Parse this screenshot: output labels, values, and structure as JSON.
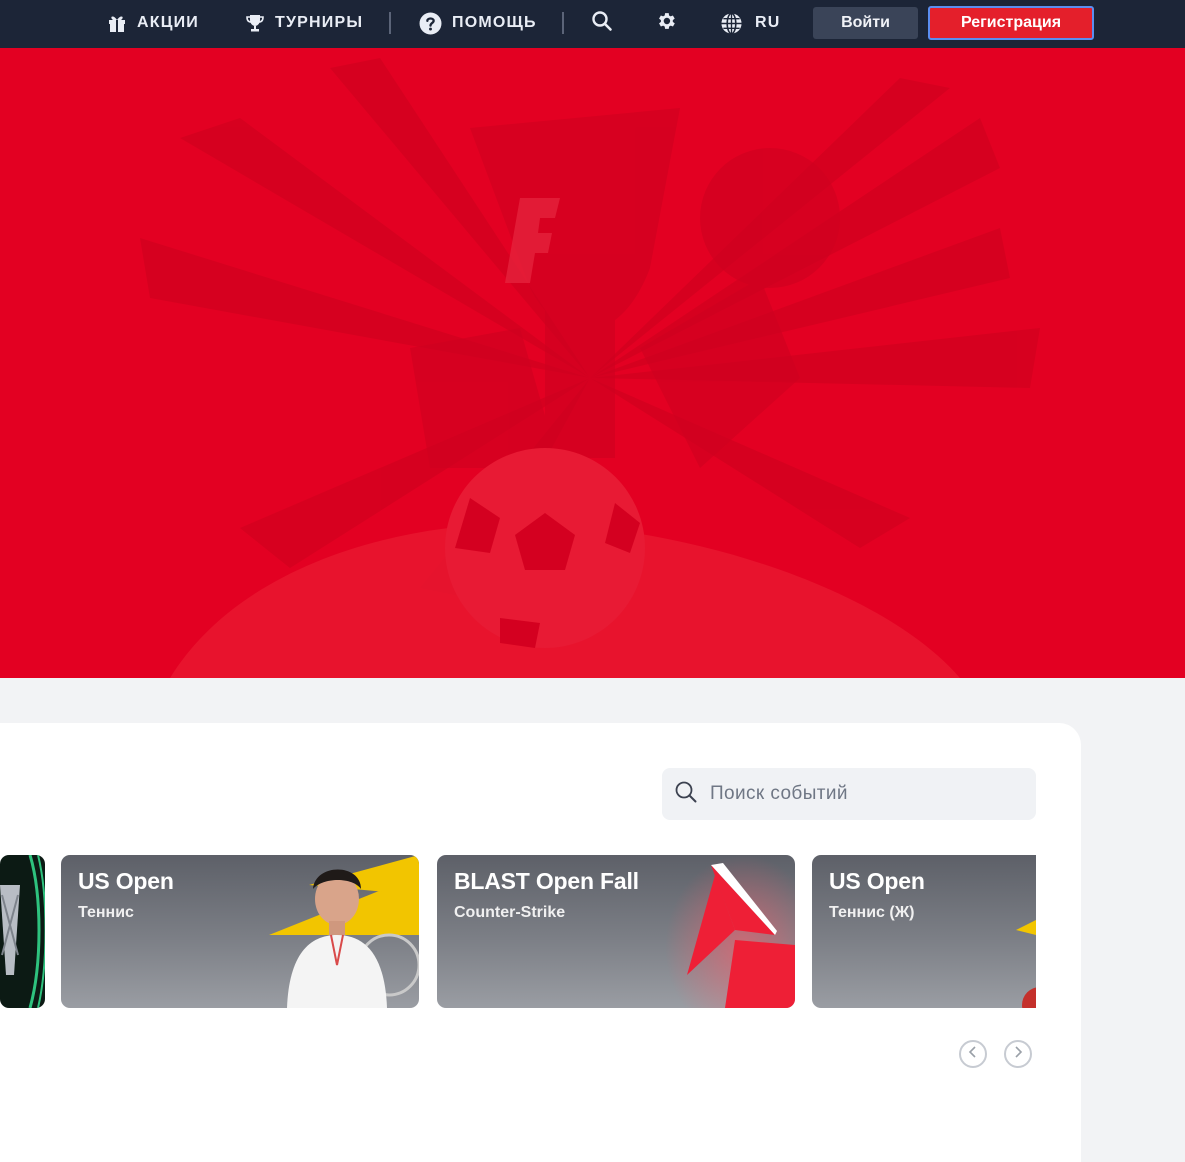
{
  "nav": {
    "promos_label": "АКЦИИ",
    "tournaments_label": "ТУРНИРЫ",
    "help_label": "ПОМОЩЬ",
    "language_label": "RU",
    "login_label": "Войти",
    "register_label": "Регистрация"
  },
  "search": {
    "placeholder": "Поиск событий"
  },
  "cards": [
    {
      "title": "US Open",
      "subtitle": "Теннис"
    },
    {
      "title": "BLAST Open Fall",
      "subtitle": "Counter-Strike"
    },
    {
      "title": "US Open",
      "subtitle": "Теннис (Ж)"
    }
  ],
  "colors": {
    "nav_bg": "#1c2537",
    "hero_bg": "#e30022",
    "register_bg": "#e41f2b",
    "login_bg": "#3a4458"
  },
  "icons": [
    "gift-icon",
    "trophy-icon",
    "help-icon",
    "search-icon",
    "gear-icon",
    "globe-icon",
    "chevron-left-icon",
    "chevron-right-icon"
  ]
}
